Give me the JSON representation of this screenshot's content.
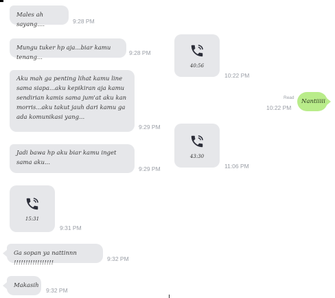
{
  "messages_in": [
    {
      "text": "Males ah sayang....",
      "time": "9:28 PM"
    },
    {
      "text": "Mungu tuker hp aja...biar kamu tenang...",
      "time": "9:28 PM"
    },
    {
      "text": "Aku mah ga penting lihat kamu line sama siapa...aku kepikiran aja kamu sendirian kamis sama jum'at aku kan morris...aku takut jauh dari kamu ga ada komunikasi yang...",
      "time": "9:29 PM"
    },
    {
      "text": "Jadi bawa hp aku biar kamu inget sama aku...",
      "time": "9:29 PM"
    },
    {
      "text": "Ga sopan ya nattinnn !!!!!!!!!!!!!!!!!",
      "time": "9:32 PM"
    },
    {
      "text": "Makasih",
      "time": "9:32 PM"
    }
  ],
  "calls": [
    {
      "duration": "40:56",
      "time": "10:22 PM",
      "icon": "phone-call-icon"
    },
    {
      "duration": "43:30",
      "time": "11:06 PM",
      "icon": "phone-call-icon"
    },
    {
      "duration": "15:31",
      "time": "9:31 PM",
      "icon": "phone-call-icon"
    }
  ],
  "message_out": {
    "text": "Nantiiiii",
    "read": "Read",
    "time": "10:22 PM"
  },
  "colors": {
    "incoming_bubble": "#e6e7ea",
    "outgoing_bubble": "#b9ec8a",
    "timestamp": "#9a9ea6"
  }
}
